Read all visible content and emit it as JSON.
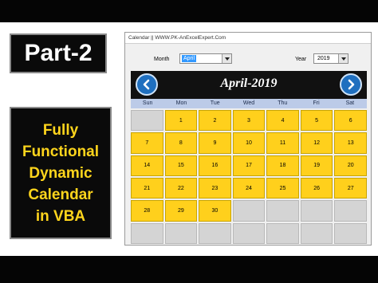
{
  "banner": {
    "part_label": "Part-2",
    "title_lines": [
      "Fully",
      "Functional",
      "Dynamic",
      "Calendar",
      "in VBA"
    ]
  },
  "window": {
    "title": "Calendar || WWW.PK-AnExcelExpert.Com",
    "month_label": "Month",
    "month_value": "April",
    "year_label": "Year",
    "year_value": "2019"
  },
  "calendar": {
    "header_title": "April-2019",
    "weekdays": [
      "Sun",
      "Mon",
      "Tue",
      "Wed",
      "Thu",
      "Fri",
      "Sat"
    ],
    "first_weekday_index": 1,
    "days_in_month": 30,
    "active_color": "#ffd01c",
    "inactive_color": "#d4d4d4"
  },
  "icons": {
    "prev": "left-arrow-icon",
    "next": "right-arrow-icon"
  }
}
